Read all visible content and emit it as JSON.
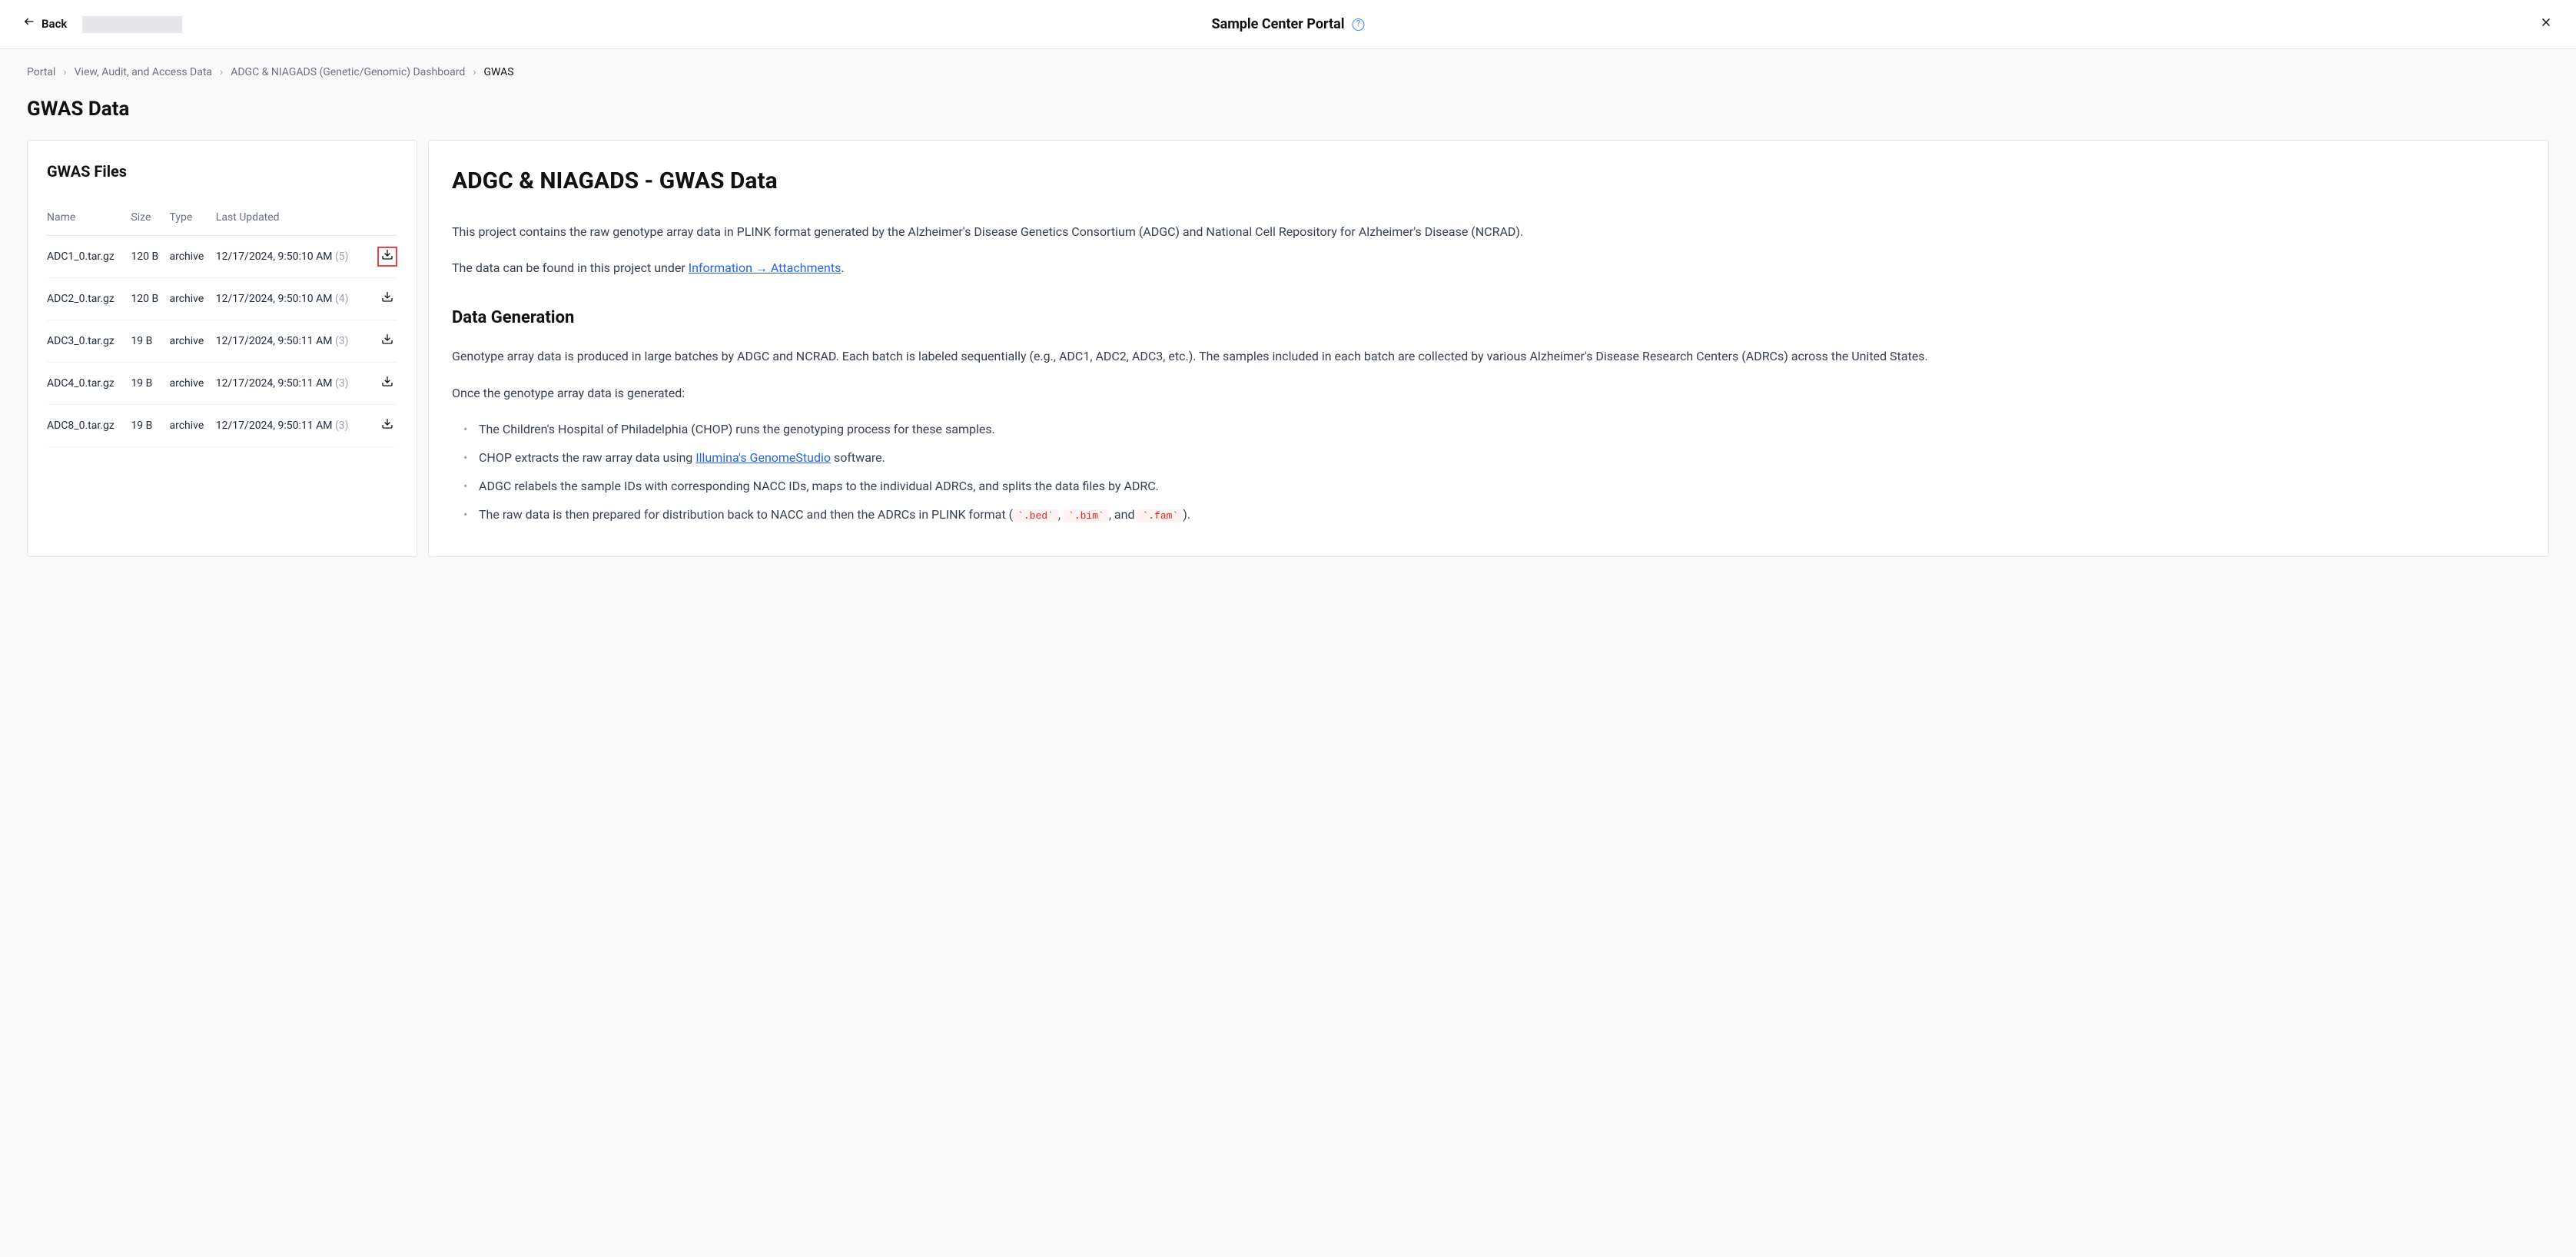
{
  "header": {
    "back_label": "Back",
    "portal_title": "Sample Center Portal",
    "help_symbol": "?"
  },
  "breadcrumb": {
    "items": [
      {
        "label": "Portal"
      },
      {
        "label": "View, Audit, and Access Data"
      },
      {
        "label": "ADGC & NIAGADS (Genetic/Genomic) Dashboard"
      }
    ],
    "current": "GWAS"
  },
  "page_title": "GWAS Data",
  "files_panel": {
    "title": "GWAS Files",
    "columns": {
      "name": "Name",
      "size": "Size",
      "type": "Type",
      "last_updated": "Last Updated"
    },
    "rows": [
      {
        "name": "ADC1_0.tar.gz",
        "size": "120 B",
        "type": "archive",
        "updated": "12/17/2024, 9:50:10 AM",
        "rev": "(5)",
        "highlighted": true
      },
      {
        "name": "ADC2_0.tar.gz",
        "size": "120 B",
        "type": "archive",
        "updated": "12/17/2024, 9:50:10 AM",
        "rev": "(4)",
        "highlighted": false
      },
      {
        "name": "ADC3_0.tar.gz",
        "size": "19 B",
        "type": "archive",
        "updated": "12/17/2024, 9:50:11 AM",
        "rev": "(3)",
        "highlighted": false
      },
      {
        "name": "ADC4_0.tar.gz",
        "size": "19 B",
        "type": "archive",
        "updated": "12/17/2024, 9:50:11 AM",
        "rev": "(3)",
        "highlighted": false
      },
      {
        "name": "ADC8_0.tar.gz",
        "size": "19 B",
        "type": "archive",
        "updated": "12/17/2024, 9:50:11 AM",
        "rev": "(3)",
        "highlighted": false
      }
    ]
  },
  "info_panel": {
    "title": "ADGC & NIAGADS - GWAS Data",
    "intro_p1": "This project contains the raw genotype array data in PLINK format generated by the Alzheimer's Disease Genetics Consortium (ADGC) and National Cell Repository for Alzheimer's Disease (NCRAD).",
    "intro_p2_prefix": "The data can be found in this project under ",
    "intro_p2_link": "Information → Attachments",
    "intro_p2_suffix": ".",
    "section1_title": "Data Generation",
    "section1_p1": "Genotype array data is produced in large batches by ADGC and NCRAD. Each batch is labeled sequentially (e.g., ADC1, ADC2, ADC3, etc.). The samples included in each batch are collected by various Alzheimer's Disease Research Centers (ADRCs) across the United States.",
    "section1_p2": "Once the genotype array data is generated:",
    "list_items": {
      "li1": "The Children's Hospital of Philadelphia (CHOP) runs the genotyping process for these samples.",
      "li2_prefix": "CHOP extracts the raw array data using ",
      "li2_link": "Illumina's GenomeStudio",
      "li2_suffix": " software.",
      "li3": "ADGC relabels the sample IDs with corresponding NACC IDs, maps to the individual ADRCs, and splits the data files by ADRC.",
      "li4_prefix": "The raw data is then prepared for distribution back to NACC and then the ADRCs in PLINK format (",
      "li4_code1": "`.bed`",
      "li4_sep1": ", ",
      "li4_code2": "`.bim`",
      "li4_sep2": ", and ",
      "li4_code3": "`.fam`",
      "li4_suffix": ")."
    }
  }
}
